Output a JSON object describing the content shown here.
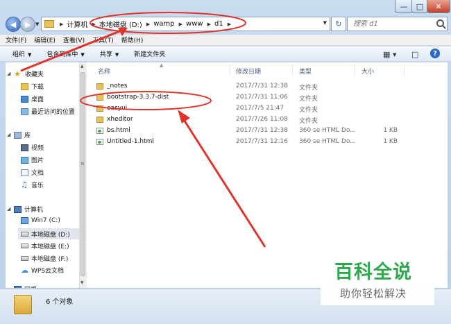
{
  "window": {
    "controls": [
      "—",
      "□",
      "✕"
    ]
  },
  "address": {
    "crumbs": [
      "计算机",
      "本地磁盘 (D:)",
      "wamp",
      "www",
      "d1"
    ],
    "search_placeholder": "搜索 d1"
  },
  "menu": [
    "文件(F)",
    "编辑(E)",
    "查看(V)",
    "工具(T)",
    "帮助(H)"
  ],
  "toolbar": {
    "organize": "组织",
    "include_in_library": "包含到库中",
    "share": "共享",
    "new_folder": "新建文件夹"
  },
  "sidebar": {
    "favorites": "收藏夹",
    "favorites_items": [
      "下载",
      "桌面",
      "最近访问的位置"
    ],
    "libraries": "库",
    "library_items": [
      "视频",
      "图片",
      "文档",
      "音乐"
    ],
    "computer": "计算机",
    "drives": [
      "Win7 (C:)",
      "本地磁盘 (D:)",
      "本地磁盘 (E:)",
      "本地磁盘 (F:)",
      "WPS云文档"
    ],
    "network": "网络"
  },
  "columns": {
    "name": "名称",
    "modified": "修改日期",
    "type": "类型",
    "size": "大小"
  },
  "files": [
    {
      "name": "_notes",
      "modified": "2017/7/31 12:38",
      "type": "文件夹",
      "size": "",
      "icon": "folder"
    },
    {
      "name": "bootstrap-3.3.7-dist",
      "modified": "2017/7/31 11:06",
      "type": "文件夹",
      "size": "",
      "icon": "folder"
    },
    {
      "name": "easyui",
      "modified": "2017/7/5 21:47",
      "type": "文件夹",
      "size": "",
      "icon": "folder"
    },
    {
      "name": "xheditor",
      "modified": "2017/7/26 11:08",
      "type": "文件夹",
      "size": "",
      "icon": "folder"
    },
    {
      "name": "bs.html",
      "modified": "2017/7/31 12:38",
      "type": "360 se HTML Do...",
      "size": "1 KB",
      "icon": "html"
    },
    {
      "name": "Untitled-1.html",
      "modified": "2017/7/31 12:16",
      "type": "360 se HTML Do...",
      "size": "1 KB",
      "icon": "html"
    }
  ],
  "status": {
    "item_count": "6 个对象"
  },
  "watermark": {
    "title": "百科全说",
    "subtitle": "助你轻松解决"
  },
  "colors": {
    "annotation": "#e0332a",
    "watermark_green": "#2fa84f"
  }
}
